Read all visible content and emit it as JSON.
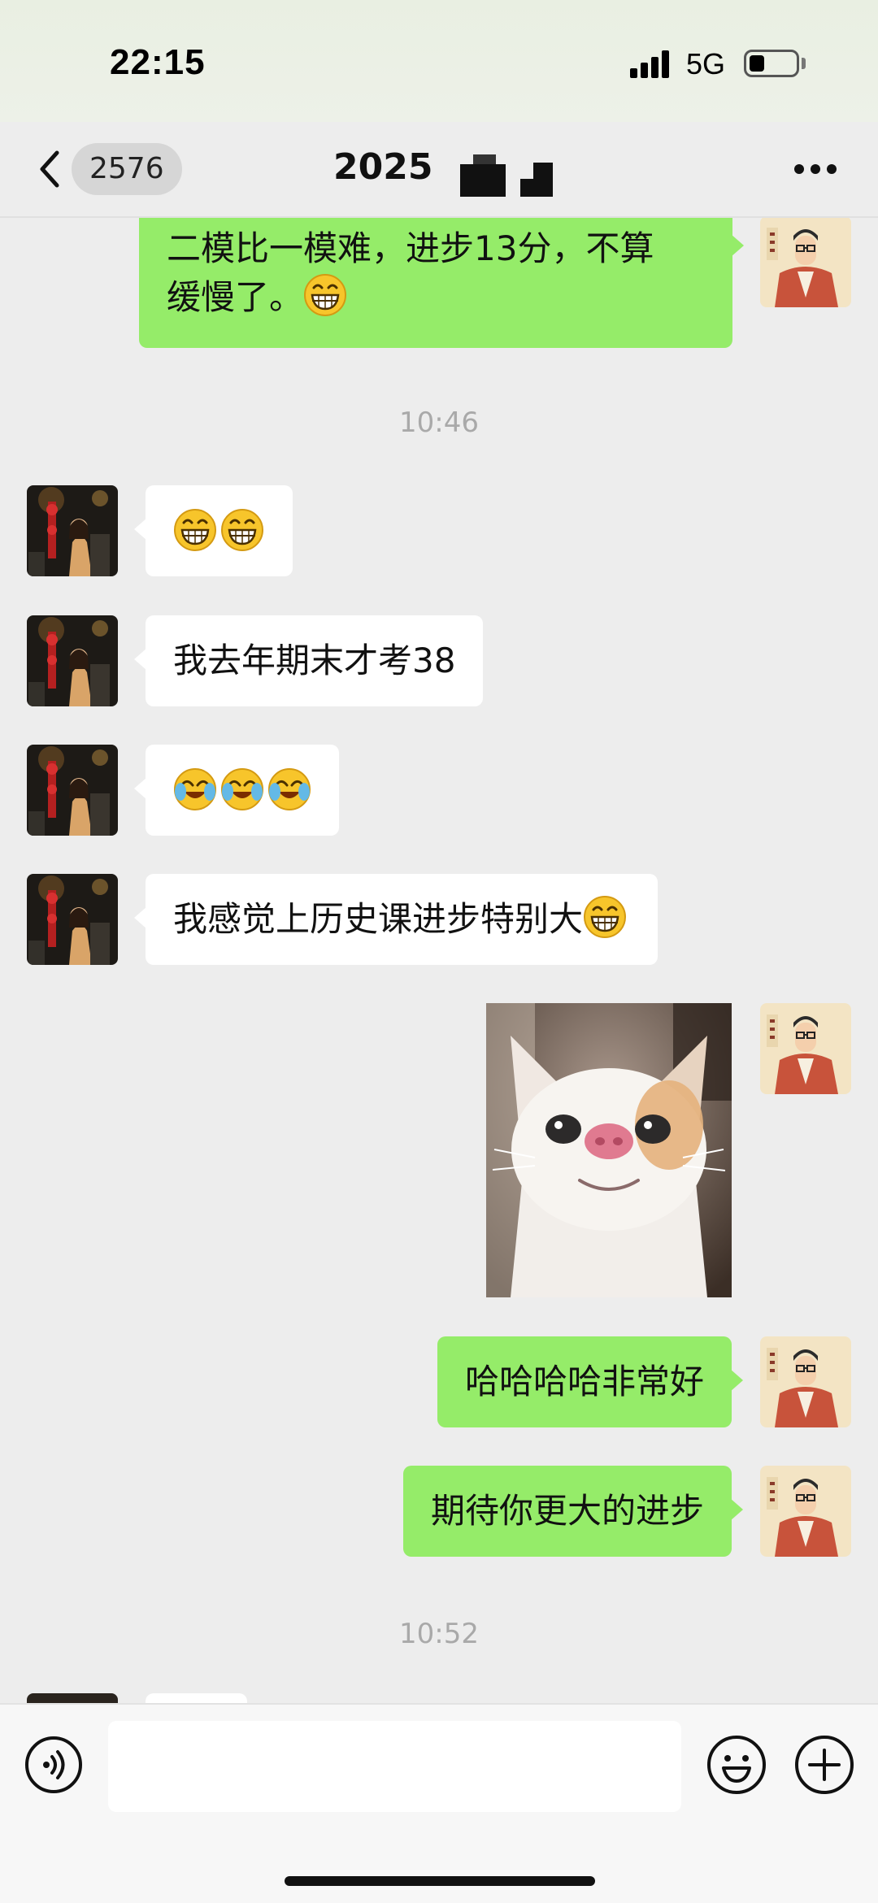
{
  "status_bar": {
    "time": "22:15",
    "network": "5G",
    "battery_level_percent": 30
  },
  "nav": {
    "back_count": "2576",
    "title": "2025"
  },
  "messages": [
    {
      "side": "right",
      "lines": [
        "二模比一模难，进步13分，不算",
        "缓慢了。"
      ],
      "trailing_emoji": "grin-emoji"
    },
    {
      "type": "timestamp",
      "text": "10:46"
    },
    {
      "side": "left",
      "emoji": [
        "grin-emoji",
        "grin-emoji"
      ]
    },
    {
      "side": "left",
      "text": "我去年期末才考38"
    },
    {
      "side": "left",
      "emoji": [
        "cry-laugh-emoji",
        "cry-laugh-emoji",
        "cry-laugh-emoji"
      ]
    },
    {
      "side": "left",
      "text": "我感觉上历史课进步特别大",
      "trailing_emoji": "grin-emoji"
    },
    {
      "side": "right",
      "image": "cat-photo"
    },
    {
      "side": "right",
      "text": "哈哈哈哈非常好"
    },
    {
      "side": "right",
      "text": "期待你更大的进步"
    },
    {
      "type": "timestamp",
      "text": "10:52"
    }
  ],
  "input_bar": {
    "placeholder": "",
    "icons": [
      "voice-icon",
      "emoji-icon",
      "plus-icon"
    ]
  },
  "colors": {
    "sent_bubble": "#95ec69",
    "received_bubble": "#ffffff",
    "background": "#ededed"
  }
}
